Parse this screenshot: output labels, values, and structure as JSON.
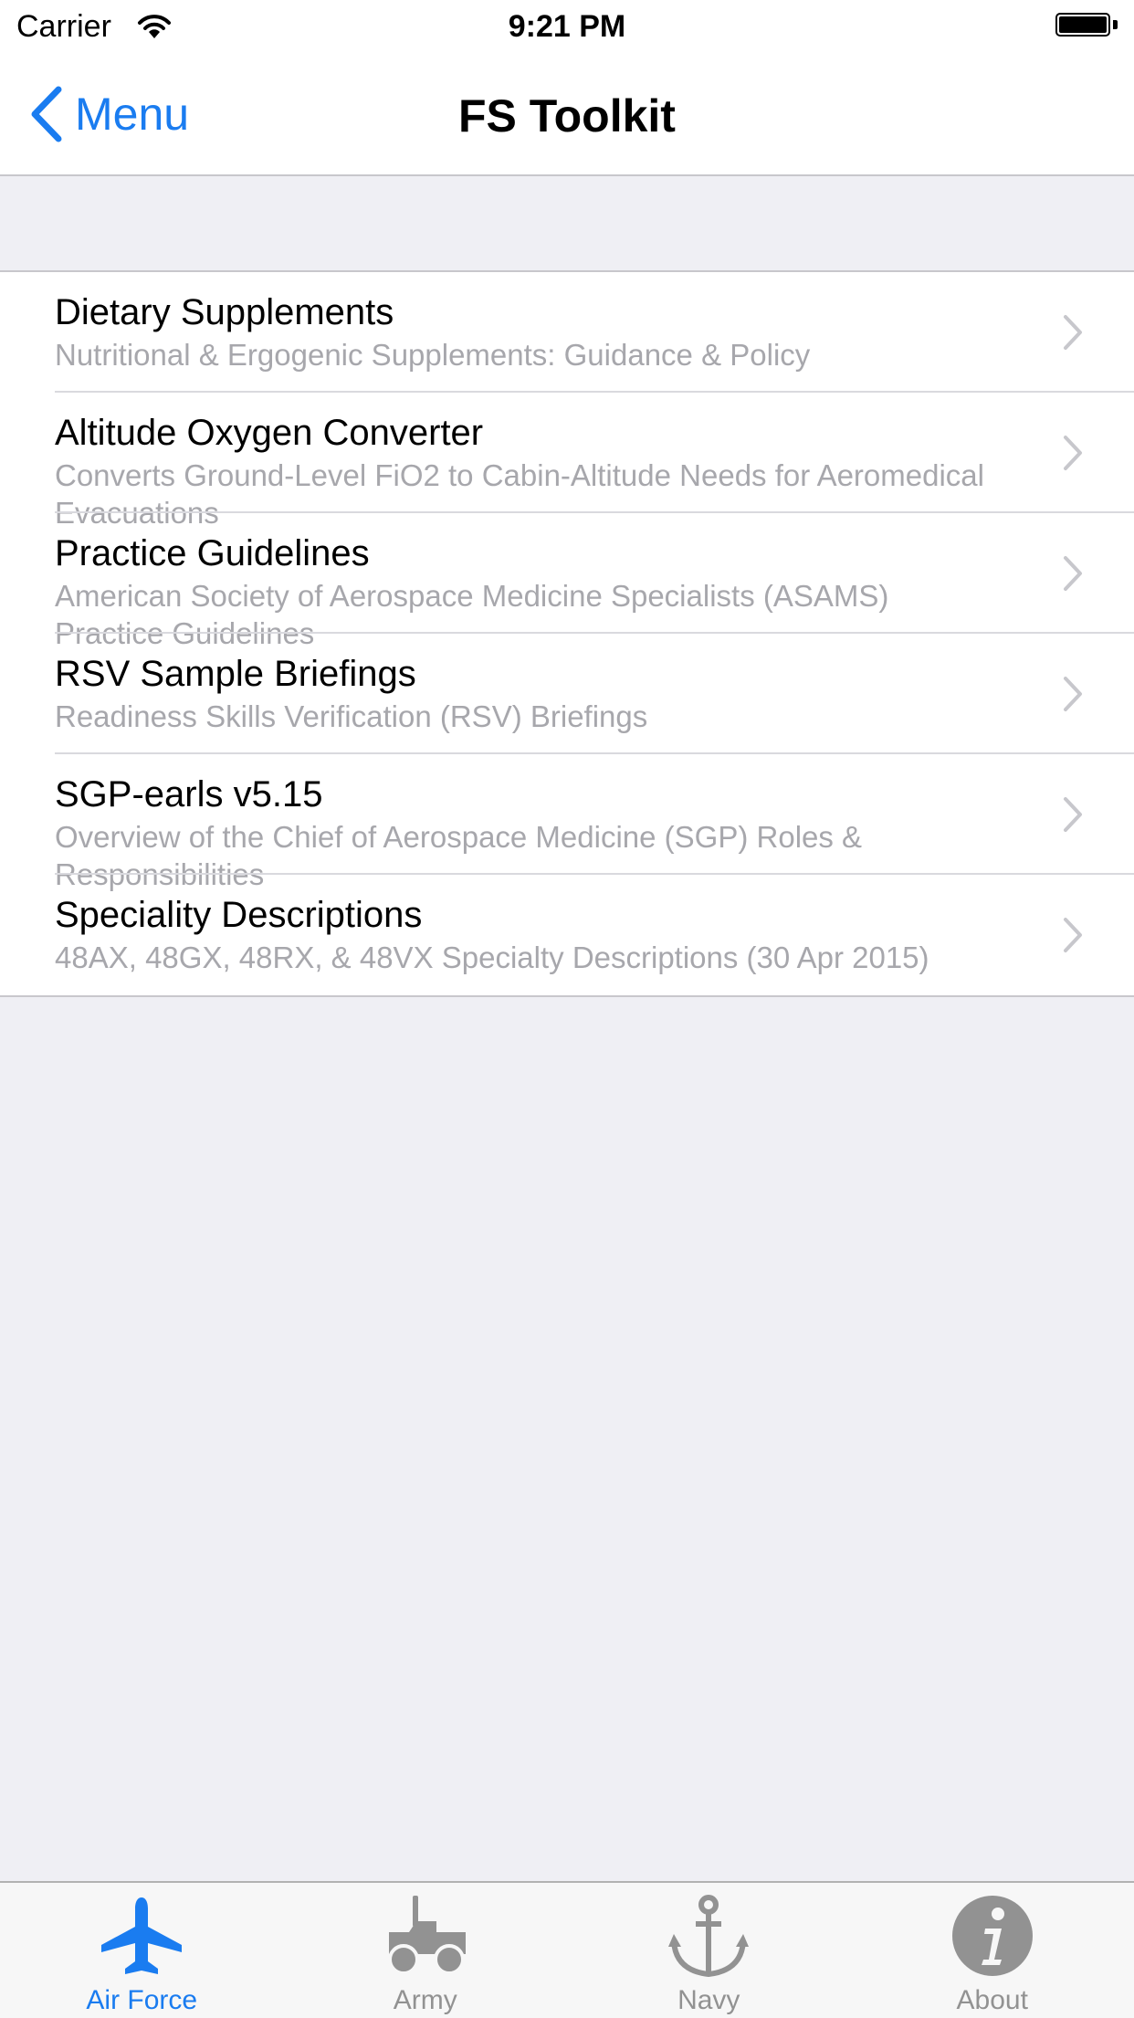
{
  "status_bar": {
    "carrier": "Carrier",
    "time": "9:21 PM"
  },
  "nav": {
    "back_label": "Menu",
    "title": "FS Toolkit"
  },
  "list": {
    "items": [
      {
        "title": "Dietary Supplements",
        "subtitle": "Nutritional & Ergogenic Supplements: Guidance & Policy"
      },
      {
        "title": "Altitude Oxygen Converter",
        "subtitle": "Converts Ground-Level FiO2 to Cabin-Altitude Needs for Aeromedical Evacuations"
      },
      {
        "title": "Practice Guidelines",
        "subtitle": "American Society of Aerospace Medicine Specialists (ASAMS) Practice Guidelines"
      },
      {
        "title": "RSV Sample Briefings",
        "subtitle": "Readiness Skills Verification (RSV) Briefings"
      },
      {
        "title": "SGP-earls v5.15",
        "subtitle": "Overview of the Chief of Aerospace Medicine (SGP) Roles & Responsibilities"
      },
      {
        "title": "Speciality Descriptions",
        "subtitle": "48AX, 48GX, 48RX, & 48VX Specialty Descriptions (30 Apr 2015)"
      }
    ]
  },
  "tabs": [
    {
      "label": "Air Force",
      "icon": "airplane-icon",
      "active": true
    },
    {
      "label": "Army",
      "icon": "jeep-icon",
      "active": false
    },
    {
      "label": "Navy",
      "icon": "anchor-icon",
      "active": false
    },
    {
      "label": "About",
      "icon": "info-icon",
      "active": false
    }
  ],
  "colors": {
    "accent": "#1a7cf0",
    "inactive_tab": "#929292",
    "subtitle": "#a7a7ac",
    "background": "#efeff4"
  }
}
